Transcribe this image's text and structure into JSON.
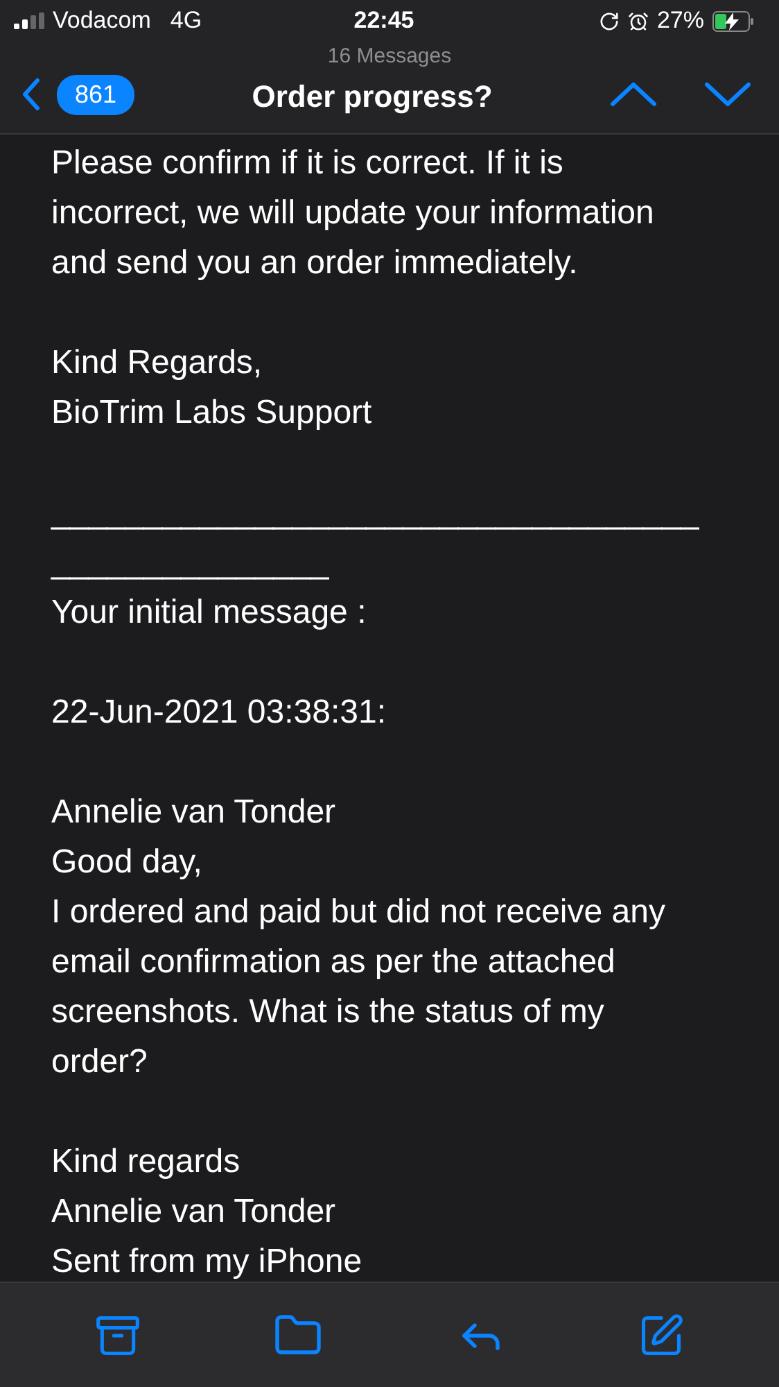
{
  "status_bar": {
    "carrier": "Vodacom",
    "network": "4G",
    "time": "22:45",
    "battery_percent": "27%"
  },
  "nav": {
    "subtitle": "16 Messages",
    "badge": "861",
    "title": "Order progress?"
  },
  "body": [
    {
      "text": "Please confirm if it is correct. If it is incorrect, we will update your information and send you an order immediately."
    },
    {
      "text": "Kind Regards,\nBioTrim Labs Support"
    },
    {
      "text": "__________________________________________________\nYour initial message :"
    },
    {
      "text": "22-Jun-2021 03:38:31:"
    },
    {
      "text": "Annelie van Tonder\nGood day,\nI ordered and paid but did not receive any email confirmation as per the attached screenshots. What is the status of my order?"
    },
    {
      "text": "Kind regards\nAnnelie van Tonder\nSent from my iPhone"
    }
  ]
}
